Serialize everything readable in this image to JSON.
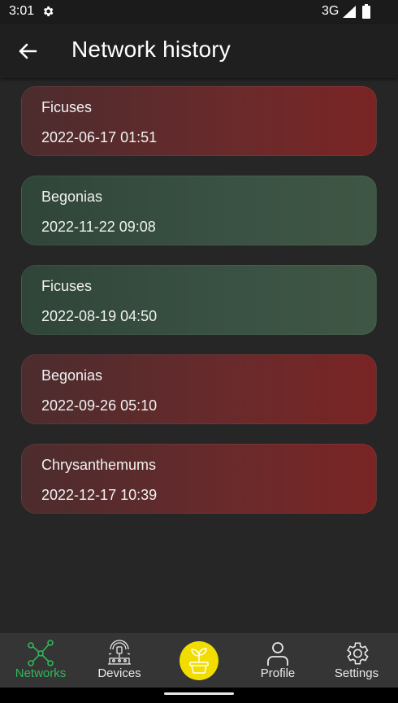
{
  "status_bar": {
    "time": "3:01",
    "network": "3G",
    "icons": [
      "gear-icon",
      "signal-icon",
      "battery-icon"
    ]
  },
  "app_bar": {
    "title": "Network history",
    "back_icon": "arrow-left-icon"
  },
  "history": [
    {
      "name": "Ficuses",
      "date": "2022-06-17 01:51",
      "status": "error"
    },
    {
      "name": "Begonias",
      "date": "2022-11-22 09:08",
      "status": "ok"
    },
    {
      "name": "Ficuses",
      "date": "2022-08-19 04:50",
      "status": "ok"
    },
    {
      "name": "Begonias",
      "date": "2022-09-26 05:10",
      "status": "error"
    },
    {
      "name": "Chrysanthemums",
      "date": "2022-12-17 10:39",
      "status": "error"
    }
  ],
  "colors": {
    "error_card": "#6a2a2b",
    "ok_card": "#3a5243",
    "active_nav": "#2fb85a",
    "fab": "#f2dd00"
  },
  "bottom_nav": {
    "items": [
      {
        "label": "Networks",
        "icon": "network-icon",
        "active": true
      },
      {
        "label": "Devices",
        "icon": "sprinkler-icon",
        "active": false
      },
      {
        "label": "",
        "icon": "plant-pot-icon",
        "active": false
      },
      {
        "label": "Profile",
        "icon": "person-icon",
        "active": false
      },
      {
        "label": "Settings",
        "icon": "gear-icon",
        "active": false
      }
    ]
  }
}
